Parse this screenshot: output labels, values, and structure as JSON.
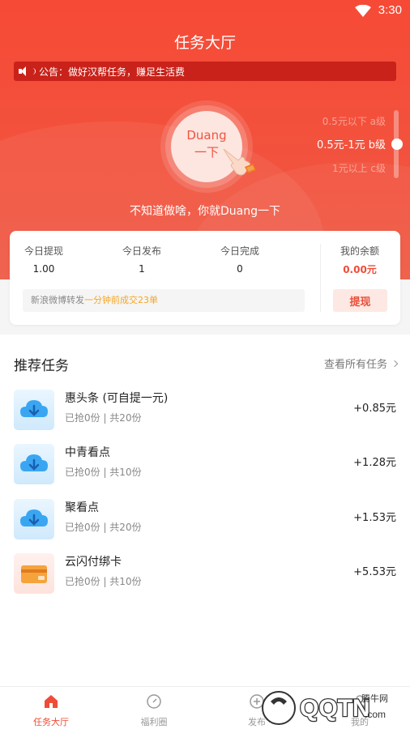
{
  "status_bar": {
    "time": "3:30"
  },
  "header": {
    "title": "任务大厅"
  },
  "notice": {
    "text": "公告：做好汉帮任务，赚足生活费"
  },
  "duang": {
    "line1": "Duang",
    "line2": "一下",
    "tagline": "不知道做啥，你就Duang一下"
  },
  "levels": [
    {
      "label": "0.5元以下 a级",
      "active": false
    },
    {
      "label": "0.5元-1元 b级",
      "active": true
    },
    {
      "label": "1元以上 c级",
      "active": false
    }
  ],
  "level_slider": {
    "selected_index": 1,
    "count": 3
  },
  "stats": {
    "items": [
      {
        "label": "今日提现",
        "value": "1.00"
      },
      {
        "label": "今日发布",
        "value": "1"
      },
      {
        "label": "今日完成",
        "value": "0"
      }
    ],
    "balance_label": "我的余额",
    "balance_value": "0.00元",
    "withdraw_label": "提现",
    "ticker_prefix": "新浪微博转发",
    "ticker_highlight": "一分钟前成交23单"
  },
  "recommended": {
    "title": "推荐任务",
    "view_all": "查看所有任务",
    "tasks": [
      {
        "name": "惠头条 (可自提一元)",
        "meta": "已抢0份 | 共20份",
        "reward": "+0.85元",
        "icon": "cloud-download-icon"
      },
      {
        "name": "中青看点",
        "meta": "已抢0份 | 共10份",
        "reward": "+1.28元",
        "icon": "cloud-download-icon"
      },
      {
        "name": "聚看点",
        "meta": "已抢0份 | 共20份",
        "reward": "+1.53元",
        "icon": "cloud-download-icon"
      },
      {
        "name": "云闪付绑卡",
        "meta": "已抢0份 | 共10份",
        "reward": "+5.53元",
        "icon": "card-icon"
      }
    ]
  },
  "tabbar": {
    "items": [
      {
        "label": "任务大厅",
        "icon": "home-icon",
        "active": true
      },
      {
        "label": "福利圈",
        "icon": "compass-icon",
        "active": false
      },
      {
        "label": "发布",
        "icon": "publish-icon",
        "active": false
      },
      {
        "label": "我的",
        "icon": "user-icon",
        "active": false
      }
    ]
  },
  "watermark": {
    "site": "腾牛网",
    "brand": "QQTN",
    "domain": ".com"
  },
  "colors": {
    "primary": "#f64a36",
    "notice_bg": "#c9221a",
    "accent_orange": "#f5a623",
    "balance": "#ef4c37"
  }
}
